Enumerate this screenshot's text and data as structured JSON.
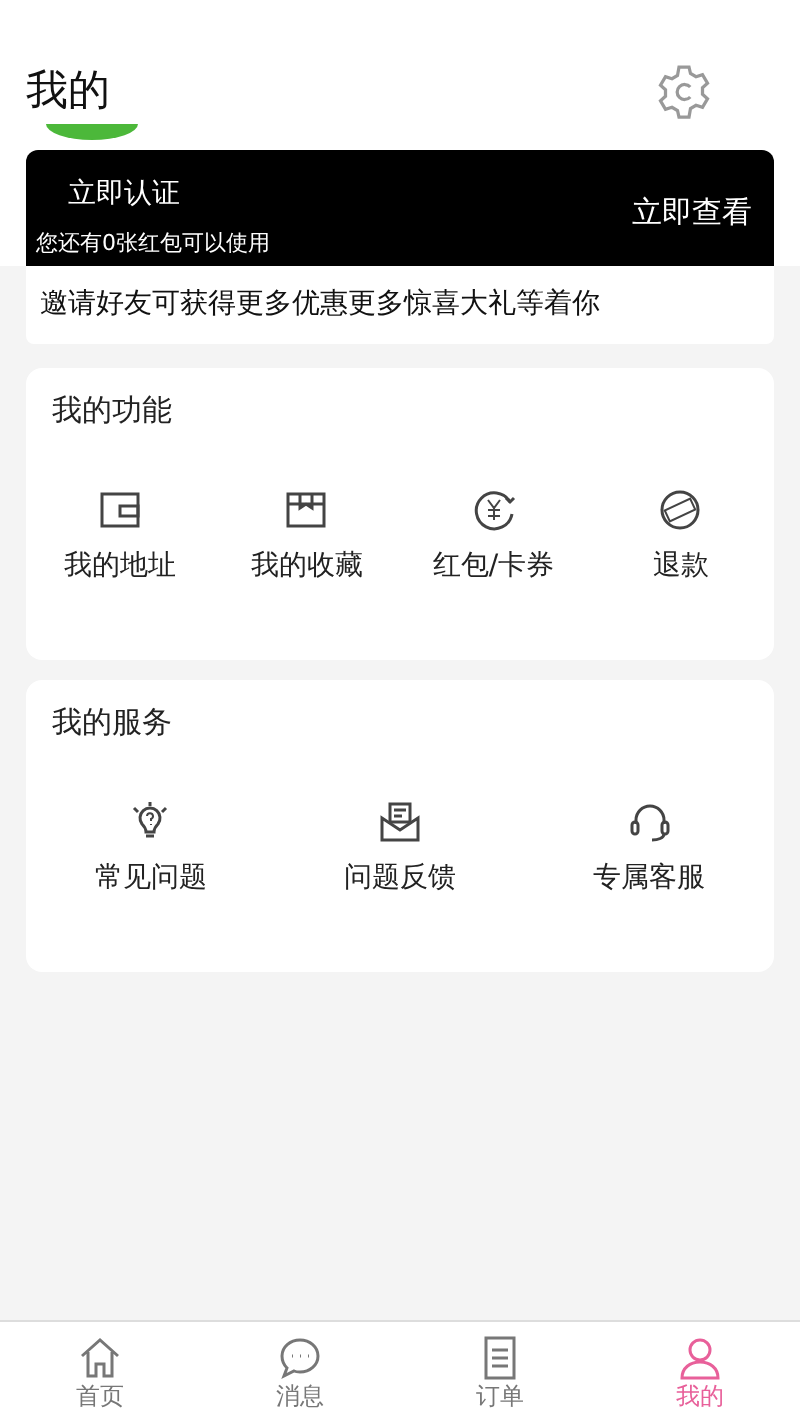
{
  "header": {
    "title": "我的"
  },
  "banner": {
    "verify": "立即认证",
    "coupon_note": "您还有0张红包可以使用",
    "view": "立即查看"
  },
  "invite": "邀请好友可获得更多优惠更多惊喜大礼等着你",
  "functions": {
    "title": "我的功能",
    "items": [
      {
        "label": "我的地址"
      },
      {
        "label": "我的收藏"
      },
      {
        "label": "红包/卡券"
      },
      {
        "label": "退款"
      }
    ]
  },
  "services": {
    "title": "我的服务",
    "items": [
      {
        "label": "常见问题"
      },
      {
        "label": "问题反馈"
      },
      {
        "label": "专属客服"
      }
    ]
  },
  "tab_bar": [
    {
      "label": "首页",
      "selected": false
    },
    {
      "label": "消息",
      "selected": false
    },
    {
      "label": "订单",
      "selected": false
    },
    {
      "label": "我的",
      "selected": true
    }
  ]
}
